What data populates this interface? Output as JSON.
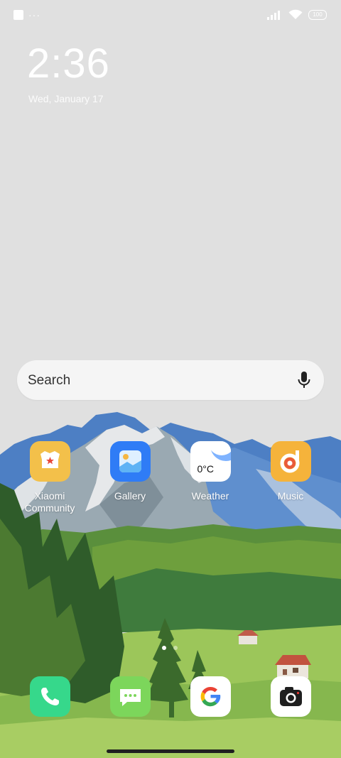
{
  "status_bar": {
    "battery": "100"
  },
  "lock": {
    "time": "2:36",
    "date": "Wed, January 17"
  },
  "search": {
    "placeholder": "Search"
  },
  "apps": [
    {
      "label": "Xiaomi\nCommunity",
      "icon": "xiaomi-community-icon"
    },
    {
      "label": "Gallery",
      "icon": "gallery-icon"
    },
    {
      "label": "Weather",
      "icon": "weather-icon",
      "temp": "0°C"
    },
    {
      "label": "Music",
      "icon": "music-icon"
    }
  ],
  "dock": [
    {
      "name": "phone",
      "icon": "phone-icon"
    },
    {
      "name": "messages",
      "icon": "messages-icon"
    },
    {
      "name": "google",
      "icon": "google-icon"
    },
    {
      "name": "camera",
      "icon": "camera-icon"
    }
  ],
  "page_indicator": {
    "pages": 2,
    "active": 1
  },
  "colors": {
    "gallery_blue": "#2f7cf6",
    "xiaomi_yellow": "#f3c04a",
    "music_orange": "#f5b33b",
    "phone_green": "#36d88b",
    "messages_green": "#7cd65b"
  }
}
